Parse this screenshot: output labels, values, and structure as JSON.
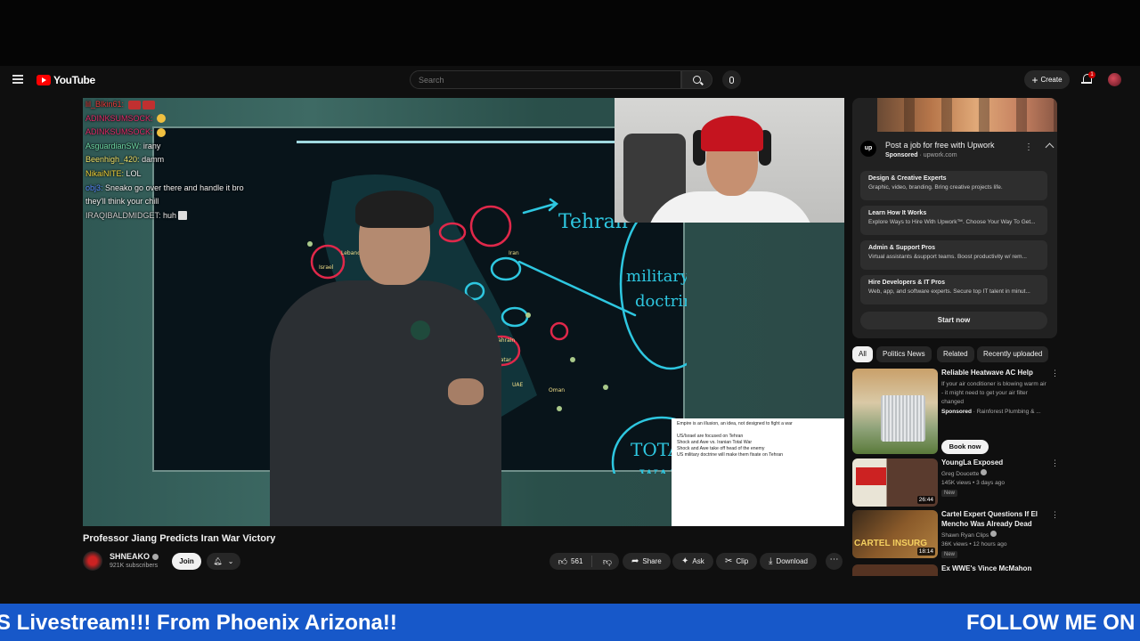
{
  "header": {
    "logo_text": "YouTube",
    "search_placeholder": "Search",
    "create_label": "Create",
    "notification_count": "1"
  },
  "video": {
    "title": "Professor Jiang Predicts Iran War Victory",
    "channel_name": "SHNEAKO",
    "subscribers": "921K subscribers",
    "join_label": "Join",
    "like_count": "561",
    "share_label": "Share",
    "ask_label": "Ask",
    "clip_label": "Clip",
    "download_label": "Download",
    "board_words": [
      "Tehran",
      "military doctrine",
      "TOTAL WAR",
      "Iran",
      "Israel",
      "Kuwait",
      "Bahrain",
      "Qatar",
      "UAE",
      "Oman",
      "Jordan",
      "Lebanon"
    ],
    "notes": [
      "Empire is an illusion, an idea, not designed to fight a war",
      "",
      "US/Israel are focused on Tehran",
      "Shock and Awe vs. Iranian Total War",
      "Shock and Awe take off head of the enemy",
      "US military doctrine will make them fixate on Tehran"
    ]
  },
  "chat": [
    {
      "user": "lil_Blkin61:",
      "text": "",
      "color": "#e83a3a"
    },
    {
      "user": "ADINKSUMSOCK:",
      "text": "",
      "color": "#e02c6a"
    },
    {
      "user": "ADINKSUMSOCK:",
      "text": "",
      "color": "#e02c6a"
    },
    {
      "user": "AsguardianSW:",
      "text": "irany",
      "color": "#6fd7a4"
    },
    {
      "user": "Beenhigh_420:",
      "text": "damm",
      "color": "#f0e46c"
    },
    {
      "user": "NikaiNITE:",
      "text": "LOL",
      "color": "#f0d23a"
    },
    {
      "user": "obj3:",
      "text": "Sneako go over there and handle it bro they'll think your chill",
      "color": "#5a8cff"
    },
    {
      "user": "IRAQIBALDMIDGET:",
      "text": "huh",
      "color": "#d0d0d0"
    }
  ],
  "ad": {
    "title": "Post a job for free with Upwork",
    "sponsored": "Sponsored",
    "domain": "upwork.com",
    "logo_text": "up",
    "items": [
      {
        "title": "Design & Creative Experts",
        "subtitle": "Graphic, video, branding. Bring creative projects life."
      },
      {
        "title": "Learn How It Works",
        "subtitle": "Explore Ways to Hire With Upwork™. Choose Your Way To Get..."
      },
      {
        "title": "Admin & Support Pros",
        "subtitle": "Virtual assistants &support teams. Boost productivity w/ rem..."
      },
      {
        "title": "Hire Developers & IT Pros",
        "subtitle": "Web, app, and software experts. Secure top IT talent in minut..."
      }
    ],
    "start_label": "Start now"
  },
  "chips": [
    "All",
    "Politics News",
    "Related",
    "Recently uploaded"
  ],
  "recs": [
    {
      "title": "Reliable Heatwave AC Help",
      "desc": "If your air conditioner is blowing warm air - it might need to get your air filter changed",
      "sponsored": "Sponsored",
      "advertiser": "Rainforest Plumbing & ...",
      "cta": "Book now"
    },
    {
      "title": "YoungLa Exposed",
      "channel": "Greg Doucette",
      "meta": "145K views • 3 days ago",
      "tag": "New",
      "duration": "26:44"
    },
    {
      "title": "Cartel Expert Questions If El Mencho Was Already Dead",
      "channel": "Shawn Ryan Clips",
      "meta": "36K views • 12 hours ago",
      "tag": "New",
      "duration": "18:14",
      "thumb_text": "CARTEL INSURG"
    },
    {
      "title": "Ex WWE's Vince McMahon"
    }
  ],
  "ticker": {
    "left_text": "S Livestream!!! From Phoenix Arizona!!",
    "right_text": "FOLLOW ME ON"
  },
  "colors": {
    "accent_red": "#ff0000",
    "ticker_blue": "#1758c9",
    "bg": "#0f0f0f"
  }
}
